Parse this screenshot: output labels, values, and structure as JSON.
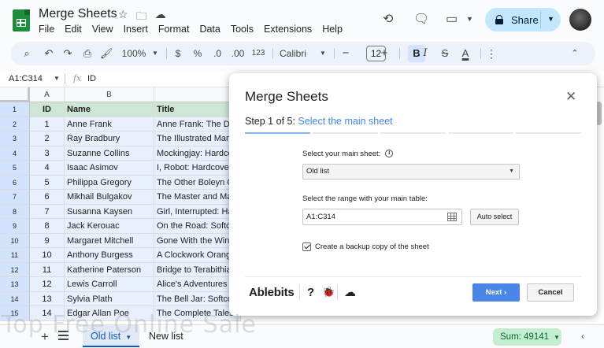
{
  "header": {
    "title": "Merge Sheets",
    "menu": [
      "File",
      "Edit",
      "View",
      "Insert",
      "Format",
      "Data",
      "Tools",
      "Extensions",
      "Help"
    ],
    "share_label": "Share"
  },
  "toolbar": {
    "zoom": "100%",
    "currency": "$",
    "percent": "%",
    "dec_decrease": ".0",
    "dec_increase": ".00",
    "number_format": "123",
    "font": "Calibri",
    "font_size": "12",
    "bold": "B",
    "italic": "I",
    "strike": "S",
    "text_color": "A"
  },
  "formula_bar": {
    "name_box": "A1:C314",
    "fx": "fx",
    "content": "ID"
  },
  "grid": {
    "columns": [
      "A",
      "B"
    ],
    "header": {
      "id": "ID",
      "name": "Name",
      "title": "Title"
    },
    "rows": [
      {
        "row": "1"
      },
      {
        "row": "2",
        "id": "1",
        "name": "Anne Frank",
        "title": "Anne Frank: The Diary"
      },
      {
        "row": "3",
        "id": "2",
        "name": "Ray Bradbury",
        "title": "The Illustrated Man"
      },
      {
        "row": "4",
        "id": "3",
        "name": "Suzanne Collins",
        "title": "Mockingjay: Hardcover"
      },
      {
        "row": "5",
        "id": "4",
        "name": "Isaac Asimov",
        "title": "I, Robot: Hardcover"
      },
      {
        "row": "6",
        "id": "5",
        "name": "Philippa Gregory",
        "title": "The Other Boleyn Girl"
      },
      {
        "row": "7",
        "id": "6",
        "name": "Mikhail Bulgakov",
        "title": "The Master and Margarita"
      },
      {
        "row": "8",
        "id": "7",
        "name": "Susanna Kaysen",
        "title": "Girl, Interrupted: Hardcover"
      },
      {
        "row": "9",
        "id": "8",
        "name": "Jack Kerouac",
        "title": "On the Road: Softcover"
      },
      {
        "row": "10",
        "id": "9",
        "name": "Margaret Mitchell",
        "title": "Gone With the Wind"
      },
      {
        "row": "11",
        "id": "10",
        "name": "Anthony Burgess",
        "title": "A Clockwork Orange"
      },
      {
        "row": "12",
        "id": "11",
        "name": "Katherine Paterson",
        "title": "Bridge to Terabithia"
      },
      {
        "row": "13",
        "id": "12",
        "name": "Lewis Carroll",
        "title": "Alice's Adventures"
      },
      {
        "row": "14",
        "id": "13",
        "name": "Sylvia Plath",
        "title": "The Bell Jar: Softcover"
      },
      {
        "row": "15",
        "id": "14",
        "name": "Edgar Allan Poe",
        "title": "The Complete Tales"
      }
    ]
  },
  "sheets": {
    "tabs": [
      "Old list",
      "New list"
    ],
    "sum": "Sum: 49141"
  },
  "dialog": {
    "title": "Merge Sheets",
    "step_prefix": "Step 1 of 5:",
    "step_name": "Select the main sheet",
    "main_sheet_label": "Select your main sheet:",
    "main_sheet_value": "Old list",
    "range_label": "Select the range with your main table:",
    "range_value": "A1:C314",
    "auto_select": "Auto select",
    "backup_label": "Create a backup copy of the sheet",
    "brand": "Ablebits",
    "help": "?",
    "next": "Next",
    "cancel": "Cancel"
  },
  "watermark": "Top Free Online Sale"
}
